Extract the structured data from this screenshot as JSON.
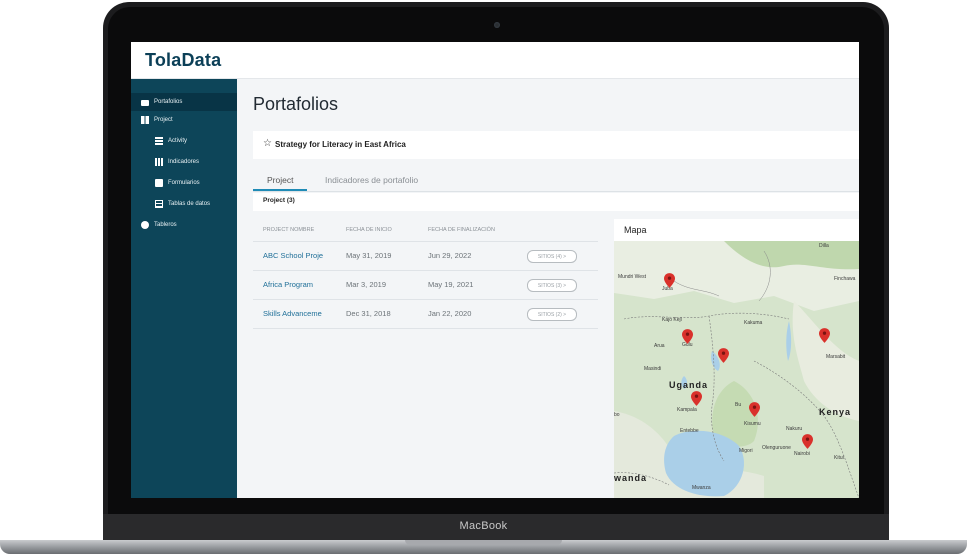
{
  "device": {
    "brand_label": "MacBook"
  },
  "app": {
    "logo": "TolaData"
  },
  "sidebar": {
    "items": [
      {
        "label": "Portafolios",
        "icon": "briefcase-icon"
      },
      {
        "label": "Project",
        "icon": "grid-icon"
      },
      {
        "label": "Activity",
        "icon": "list-icon"
      },
      {
        "label": "Indicadores",
        "icon": "bar-chart-icon"
      },
      {
        "label": "Formularios",
        "icon": "form-icon"
      },
      {
        "label": "Tablas de datos",
        "icon": "table-icon"
      },
      {
        "label": "Tableros",
        "icon": "dashboard-icon"
      }
    ]
  },
  "main": {
    "title": "Portafolios",
    "portfolio": {
      "star_icon": "☆",
      "name": "Strategy for Literacy in East Africa"
    },
    "tabs": [
      {
        "label": "Project"
      },
      {
        "label": "Indicadores de portafolio"
      }
    ],
    "subhead": "Project (3)",
    "table": {
      "headers": [
        "PROJECT NOMBRE",
        "FECHA DE INICIO",
        "FECHA DE FINALIZACIÓN"
      ],
      "rows": [
        {
          "name": "ABC School Proje",
          "start": "May 31, 2019",
          "end": "Jun 29, 2022",
          "sites": "SITIOS (4) >"
        },
        {
          "name": "Africa Program",
          "start": "Mar 3, 2019",
          "end": "May 19, 2021",
          "sites": "SITIOS (3) >"
        },
        {
          "name": "Skills Advanceme",
          "start": "Dec 31, 2018",
          "end": "Jan 22, 2020",
          "sites": "SITIOS (2) >"
        }
      ]
    },
    "map": {
      "title": "Mapa",
      "labels": {
        "uganda": "Uganda",
        "kenya": "Kenya",
        "rwanda": "wanda",
        "juba": "Juba",
        "mundri": "Mundri West",
        "gulu": "Gulu",
        "kampala": "Kampala",
        "entebbe": "Entebbe",
        "kisumu": "Kisumu",
        "nairobi": "Nairobi",
        "nakuru": "Nakuru",
        "marsabit": "Marsabit",
        "kakuma": "Kakuma",
        "kajokeji": "Kajo Keji",
        "arua": "Arua",
        "masindi": "Masindi",
        "mwanza": "Mwanza",
        "migori": "Migori",
        "kitui": "Kitui",
        "dilla": "Dilla",
        "finchawa": "Finchawa",
        "olenguruone": "Olenguruone",
        "bu": "Bu",
        "bo": "bo"
      },
      "pin_color": "#d9312b"
    }
  }
}
